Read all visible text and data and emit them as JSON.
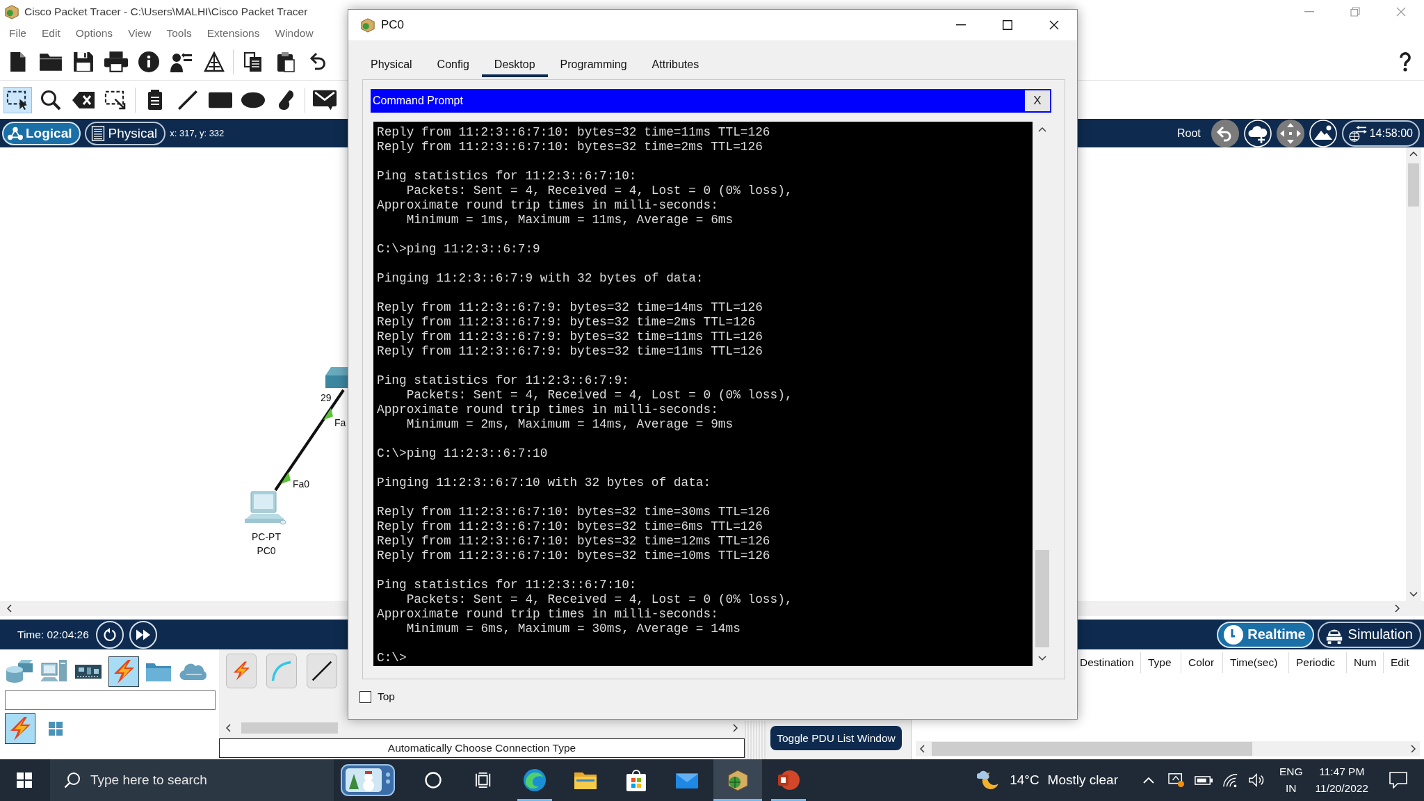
{
  "app": {
    "title": "Cisco Packet Tracer - C:\\Users\\MALHI\\Cisco Packet Tracer",
    "menu": [
      "File",
      "Edit",
      "Options",
      "View",
      "Tools",
      "Extensions",
      "Window"
    ]
  },
  "drawing_tools": [
    {
      "kind": "select",
      "selected": true
    },
    {
      "kind": "inspect",
      "selected": false
    },
    {
      "kind": "delete",
      "selected": false
    },
    {
      "kind": "resize",
      "selected": false
    },
    {
      "kind": "note",
      "selected": false
    },
    {
      "kind": "line",
      "selected": false
    },
    {
      "kind": "rectangle",
      "selected": false
    },
    {
      "kind": "ellipse",
      "selected": false
    },
    {
      "kind": "freeform",
      "selected": false
    },
    {
      "kind": "pdu",
      "selected": false
    }
  ],
  "workspace_bar": {
    "views": [
      {
        "kind": "logical",
        "label": "Logical",
        "selected": true
      },
      {
        "kind": "physical",
        "label": "Physical",
        "selected": false
      }
    ],
    "pointer": "x: 317, y: 332",
    "location": "Root",
    "clock": "14:58:00"
  },
  "canvas": {
    "devices": [
      {
        "kind": "pc",
        "labels": [
          "PC-PT",
          "PC0"
        ],
        "port": "Fa0"
      },
      {
        "kind": "switch",
        "labels": [
          "29"
        ],
        "port": "Fa"
      }
    ]
  },
  "time_bar": {
    "time": "Time: 02:04:26",
    "modes": [
      {
        "kind": "realtime",
        "label": "Realtime",
        "selected": true
      },
      {
        "kind": "simulation",
        "label": "Simulation",
        "selected": false
      }
    ]
  },
  "device_palette": {
    "categories": [
      {
        "kind": "network",
        "selected": false
      },
      {
        "kind": "enddevices",
        "selected": false
      },
      {
        "kind": "components",
        "selected": false
      },
      {
        "kind": "connections",
        "selected": true
      },
      {
        "kind": "miscellaneous",
        "selected": false
      },
      {
        "kind": "multiuser",
        "selected": false
      }
    ],
    "subcategories": [
      {
        "kind": "connections",
        "selected": true
      },
      {
        "kind": "grid",
        "selected": false
      }
    ]
  },
  "connection_types": {
    "status": "Automatically Choose Connection Type"
  },
  "pdu_list": {
    "toggle_button": "Toggle PDU List Window",
    "columns": [
      "Destination",
      "Type",
      "Color",
      "Time(sec)",
      "Periodic",
      "Num",
      "Edit"
    ]
  },
  "pc_window": {
    "title": "PC0",
    "tabs": [
      {
        "label": "Physical",
        "selected": false
      },
      {
        "label": "Config",
        "selected": false
      },
      {
        "label": "Desktop",
        "selected": true
      },
      {
        "label": "Programming",
        "selected": false
      },
      {
        "label": "Attributes",
        "selected": false
      }
    ],
    "panel_title": "Command Prompt",
    "panel_close": "X",
    "output": [
      [
        "Reply from 11:2:3::6:7:10: bytes=32 time=11ms TTL=126",
        "Reply from 11:2:3::6:7:10: bytes=32 time=2ms TTL=126"
      ],
      [
        "Ping statistics for 11:2:3::6:7:10:",
        "    Packets: Sent = 4, Received = 4, Lost = 0 (0% loss),",
        "Approximate round trip times in milli-seconds:",
        "    Minimum = 1ms, Maximum = 11ms, Average = 6ms"
      ],
      [
        "C:\\>ping 11:2:3::6:7:9"
      ],
      [
        "Pinging 11:2:3::6:7:9 with 32 bytes of data:"
      ],
      [
        "Reply from 11:2:3::6:7:9: bytes=32 time=14ms TTL=126",
        "Reply from 11:2:3::6:7:9: bytes=32 time=2ms TTL=126",
        "Reply from 11:2:3::6:7:9: bytes=32 time=11ms TTL=126",
        "Reply from 11:2:3::6:7:9: bytes=32 time=11ms TTL=126"
      ],
      [
        "Ping statistics for 11:2:3::6:7:9:",
        "    Packets: Sent = 4, Received = 4, Lost = 0 (0% loss),",
        "Approximate round trip times in milli-seconds:",
        "    Minimum = 2ms, Maximum = 14ms, Average = 9ms"
      ],
      [
        "C:\\>ping 11:2:3::6:7:10"
      ],
      [
        "Pinging 11:2:3::6:7:10 with 32 bytes of data:"
      ],
      [
        "Reply from 11:2:3::6:7:10: bytes=32 time=30ms TTL=126",
        "Reply from 11:2:3::6:7:10: bytes=32 time=6ms TTL=126",
        "Reply from 11:2:3::6:7:10: bytes=32 time=12ms TTL=126",
        "Reply from 11:2:3::6:7:10: bytes=32 time=10ms TTL=126"
      ],
      [
        "Ping statistics for 11:2:3::6:7:10:",
        "    Packets: Sent = 4, Received = 4, Lost = 0 (0% loss),",
        "Approximate round trip times in milli-seconds:",
        "    Minimum = 6ms, Maximum = 30ms, Average = 14ms"
      ],
      [
        "C:\\>"
      ]
    ],
    "stay_on_top": {
      "label": "Top",
      "checked": false
    }
  },
  "taskbar": {
    "search": {
      "placeholder": "Type here to search"
    },
    "apps": [
      {
        "kind": "browser",
        "open": true,
        "active": false
      },
      {
        "kind": "files",
        "open": false,
        "active": false
      },
      {
        "kind": "store",
        "open": false,
        "active": false
      },
      {
        "kind": "mail",
        "open": false,
        "active": false
      },
      {
        "kind": "packettracer",
        "open": true,
        "active": true
      },
      {
        "kind": "presentation",
        "open": true,
        "active": false
      }
    ],
    "weather": {
      "temperature": "14°C",
      "condition": "Mostly clear"
    },
    "language": "ENG",
    "region": "IN",
    "time": "11:47 PM",
    "date": "11/20/2022"
  }
}
